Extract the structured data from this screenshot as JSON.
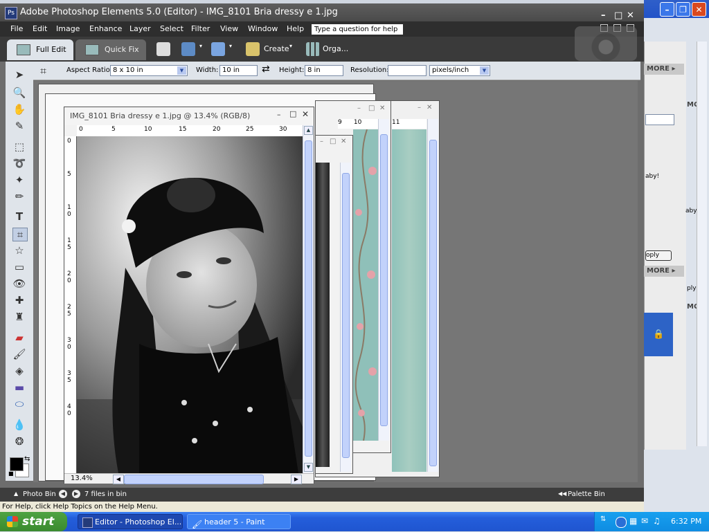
{
  "app": {
    "title": "Adobe Photoshop Elements 5.0 (Editor) - IMG_8101 Bria dressy e 1.jpg",
    "icon_label": "Ps"
  },
  "menu": [
    "File",
    "Edit",
    "Image",
    "Enhance",
    "Layer",
    "Select",
    "Filter",
    "View",
    "Window",
    "Help"
  ],
  "question_box": "Type a question for help",
  "toolbar": {
    "full_edit": "Full Edit",
    "quick_fix": "Quick Fix",
    "create": "Create",
    "organizer": "Orga..."
  },
  "options": {
    "aspect_label": "Aspect Ratio:",
    "aspect_value": "8 x 10 in",
    "width_label": "Width:",
    "width_value": "10 in",
    "height_label": "Height:",
    "height_value": "8 in",
    "resolution_label": "Resolution:",
    "resolution_value": "",
    "resolution_unit": "pixels/inch"
  },
  "document": {
    "title": "IMG_8101 Bria dressy e 1.jpg @ 13.4% (RGB/8)",
    "zoom": "13.4%",
    "h_ruler": [
      "0",
      "5",
      "10",
      "15",
      "20",
      "25",
      "30"
    ],
    "v_ruler": [
      "0",
      "5",
      "1 0",
      "1 5",
      "2 0",
      "2 5",
      "3 0",
      "3 5",
      "4 0"
    ]
  },
  "status": {
    "photo_bin": "Photo Bin",
    "files_in_bin": "7 files in bin",
    "palette_bin": "Palette Bin"
  },
  "help_text": "For Help, click Help Topics on the Help Menu.",
  "side": {
    "more1": "MORE ▸",
    "more2": "MORE ▸",
    "mc1": "MC",
    "mc2": "MC",
    "mc3": "MC",
    "text1": "aby!",
    "text2": "aby",
    "apply1": "oply",
    "apply2": "ply"
  },
  "taskbar": {
    "start": "start",
    "task1": "Editor - Photoshop El...",
    "task2": "header 5 - Paint",
    "clock": "6:32 PM"
  },
  "colors": {
    "xp_blue": "#245edb",
    "pse_dark": "#3a3a3a",
    "teal_paper": "#8fc0b9"
  }
}
